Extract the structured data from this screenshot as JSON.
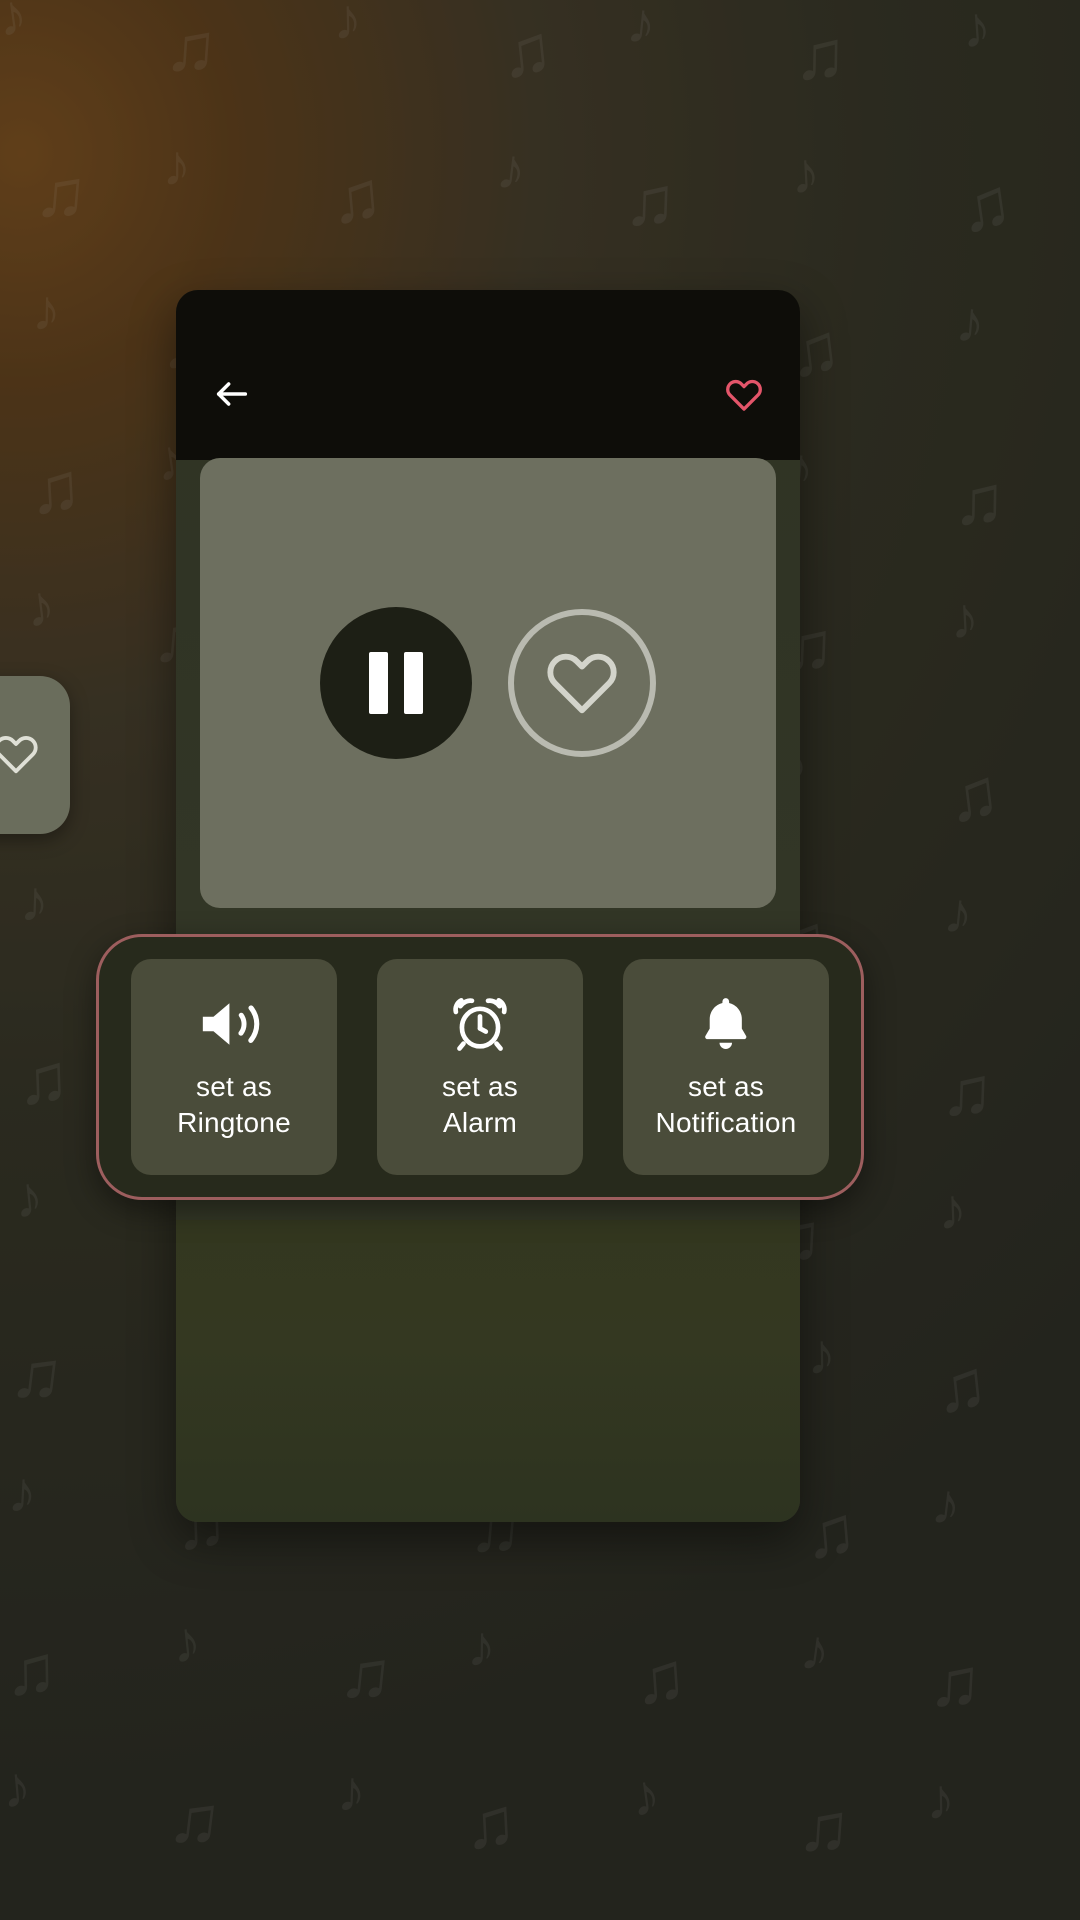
{
  "wallpaper": {
    "note_glyph": "♪",
    "note_glyph_alt": "♫",
    "base_color": "#3e3d2d",
    "accent_glow": "#8a5a25"
  },
  "left_peek_card": {
    "name": "favorite-card",
    "icon": "heart-outline-icon"
  },
  "header": {
    "back_icon": "arrow-left-icon",
    "favorite_icon": "heart-outline-icon",
    "favorite_color": "#e4556a",
    "background_color": "#0e0d09"
  },
  "player": {
    "panel_color": "#6d6f5f",
    "pause_button": {
      "name": "pause-button",
      "icon": "pause-icon",
      "state": "playing",
      "background_color": "#1d1f15"
    },
    "like_button": {
      "name": "like-button",
      "icon": "heart-outline-icon",
      "border_color": "#b9bab0"
    }
  },
  "actions": {
    "highlight_color": "#9d5e5e",
    "background_color": "#272a1c",
    "items": [
      {
        "id": "set-as-ringtone",
        "icon": "speaker-volume-icon",
        "label_line1": "set as",
        "label_line2": "Ringtone"
      },
      {
        "id": "set-as-alarm",
        "icon": "alarm-clock-icon",
        "label_line1": "set as",
        "label_line2": "Alarm"
      },
      {
        "id": "set-as-notification",
        "icon": "bell-icon",
        "label_line1": "set as",
        "label_line2": "Notification"
      }
    ]
  }
}
